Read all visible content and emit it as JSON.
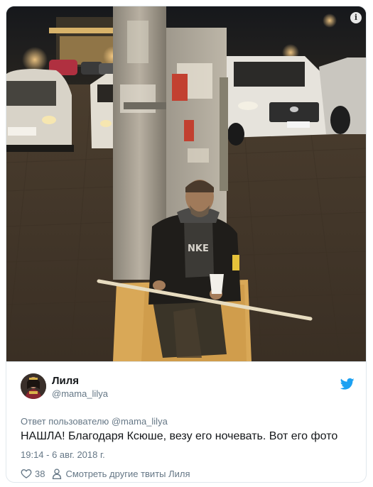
{
  "tweet": {
    "author_name": "Лиля",
    "author_handle": "@mama_lilya",
    "reply_prefix": "Ответ пользователю",
    "reply_to": "@mama_lilya",
    "text": "НАШЛА! Благодаря Ксюше, везу его ночевать. Вот его фото",
    "timestamp": "19:14 - 6 авг. 2018 г.",
    "like_count": "38",
    "more_tweets_label": "Смотреть другие твиты Лиля"
  },
  "icons": {
    "info": "info-icon",
    "brand": "twitter-bird-icon",
    "like": "heart-icon",
    "profile": "person-icon"
  },
  "colors": {
    "brand": "#1da1f2",
    "secondary_text": "#657786",
    "border": "#e1e8ed"
  }
}
